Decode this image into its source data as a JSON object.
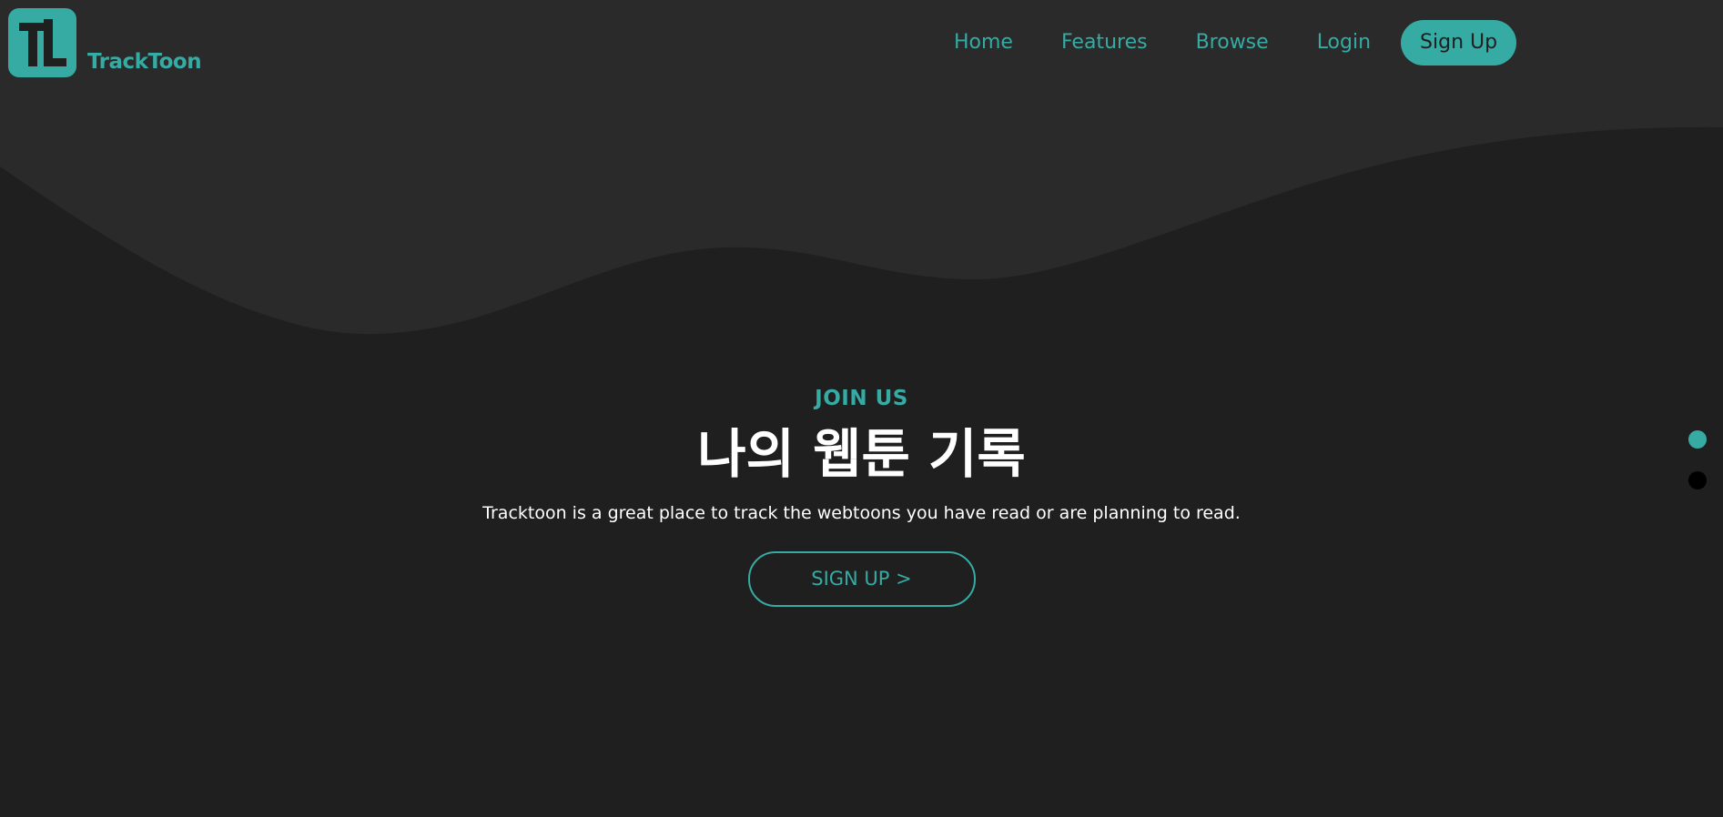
{
  "brand": {
    "name": "TrackToon",
    "logo_letters": "TL",
    "accent_color": "#35aba4"
  },
  "nav": {
    "items": [
      {
        "label": "Home"
      },
      {
        "label": "Features"
      },
      {
        "label": "Browse"
      },
      {
        "label": "Login"
      }
    ],
    "signup_label": "Sign Up"
  },
  "hero": {
    "eyebrow": "JOIN US",
    "title": "나의 웹툰 기록",
    "description": "Tracktoon is a great place to track the webtoons you have read or are planning to read.",
    "cta_label": "SIGN UP >"
  },
  "slider": {
    "dots": [
      {
        "state": "active"
      },
      {
        "state": "inactive"
      }
    ]
  },
  "colors": {
    "background": "#1f1f1f",
    "wave": "#2a2a2a",
    "text": "#ffffff"
  }
}
